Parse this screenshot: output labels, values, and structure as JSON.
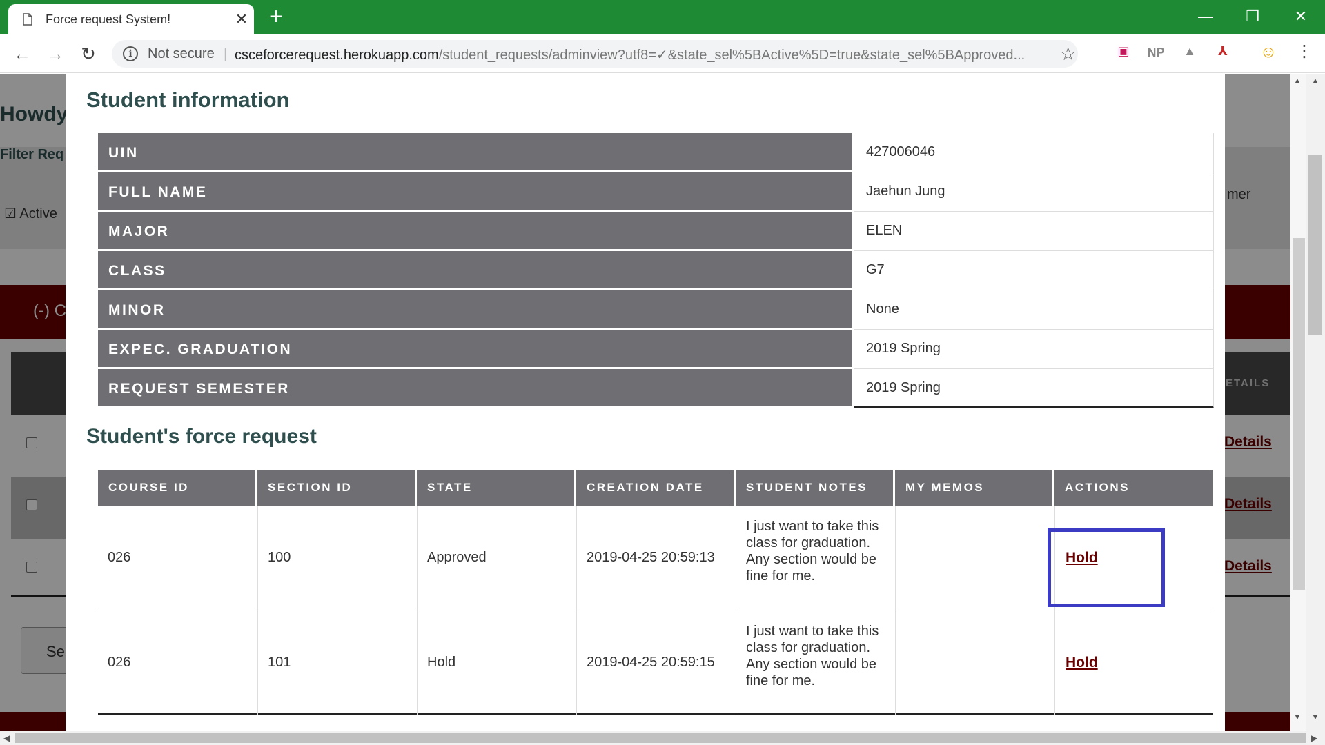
{
  "browser": {
    "tab_title": "Force request System!",
    "tab_close": "✕",
    "new_tab": "+",
    "window_controls": {
      "minimize": "—",
      "restore": "❐",
      "close": "✕"
    },
    "nav": {
      "back": "←",
      "forward": "→",
      "reload": "↻"
    },
    "security_icon": "i",
    "security_label": "Not secure",
    "url_host": "csceforcerequest.herokuapp.com",
    "url_path": "/student_requests/adminview?utf8=✓&state_sel%5BActive%5D=true&state_sel%5BApproved...",
    "bookmark_icon": "☆",
    "extensions": [
      "▣",
      "NP",
      "▲",
      "⅄",
      "☺"
    ],
    "menu": "⋮"
  },
  "background_page": {
    "howdy": "Howdy",
    "filter_label": "Filter Req",
    "active_checkbox": "☑",
    "active_label": "Active",
    "partial_mer": "mer",
    "red_bar_text": "(-) C",
    "details_header": "ETAILS",
    "details_link": "Details",
    "select_button": "Se"
  },
  "modal": {
    "student_info_title": "Student information",
    "student_info": [
      {
        "label": "UIN",
        "value": "427006046"
      },
      {
        "label": "FULL NAME",
        "value": "Jaehun Jung"
      },
      {
        "label": "MAJOR",
        "value": "ELEN"
      },
      {
        "label": "CLASS",
        "value": "G7"
      },
      {
        "label": "MINOR",
        "value": "None"
      },
      {
        "label": "EXPEC. GRADUATION",
        "value": "2019 Spring"
      },
      {
        "label": "REQUEST SEMESTER",
        "value": "2019 Spring"
      }
    ],
    "force_request_title": "Student's force request",
    "columns": [
      "COURSE ID",
      "SECTION ID",
      "STATE",
      "CREATION DATE",
      "STUDENT NOTES",
      "MY MEMOS",
      "ACTIONS"
    ],
    "rows": [
      {
        "course_id": "026",
        "section_id": "100",
        "state": "Approved",
        "creation_date": "2019-04-25 20:59:13",
        "notes": "I just want to take this class for graduation. Any section would be fine for me.",
        "memos": "",
        "action": "Hold"
      },
      {
        "course_id": "026",
        "section_id": "101",
        "state": "Hold",
        "creation_date": "2019-04-25 20:59:15",
        "notes": "I just want to take this class for graduation. Any section would be fine for me.",
        "memos": "",
        "action": "Hold"
      }
    ]
  },
  "colors": {
    "chrome_green": "#1e8a34",
    "header_gray": "#6e6e73",
    "title_teal": "#2f4f4f",
    "link_maroon": "#6b0000",
    "highlight_blue": "#3b3bc4"
  }
}
